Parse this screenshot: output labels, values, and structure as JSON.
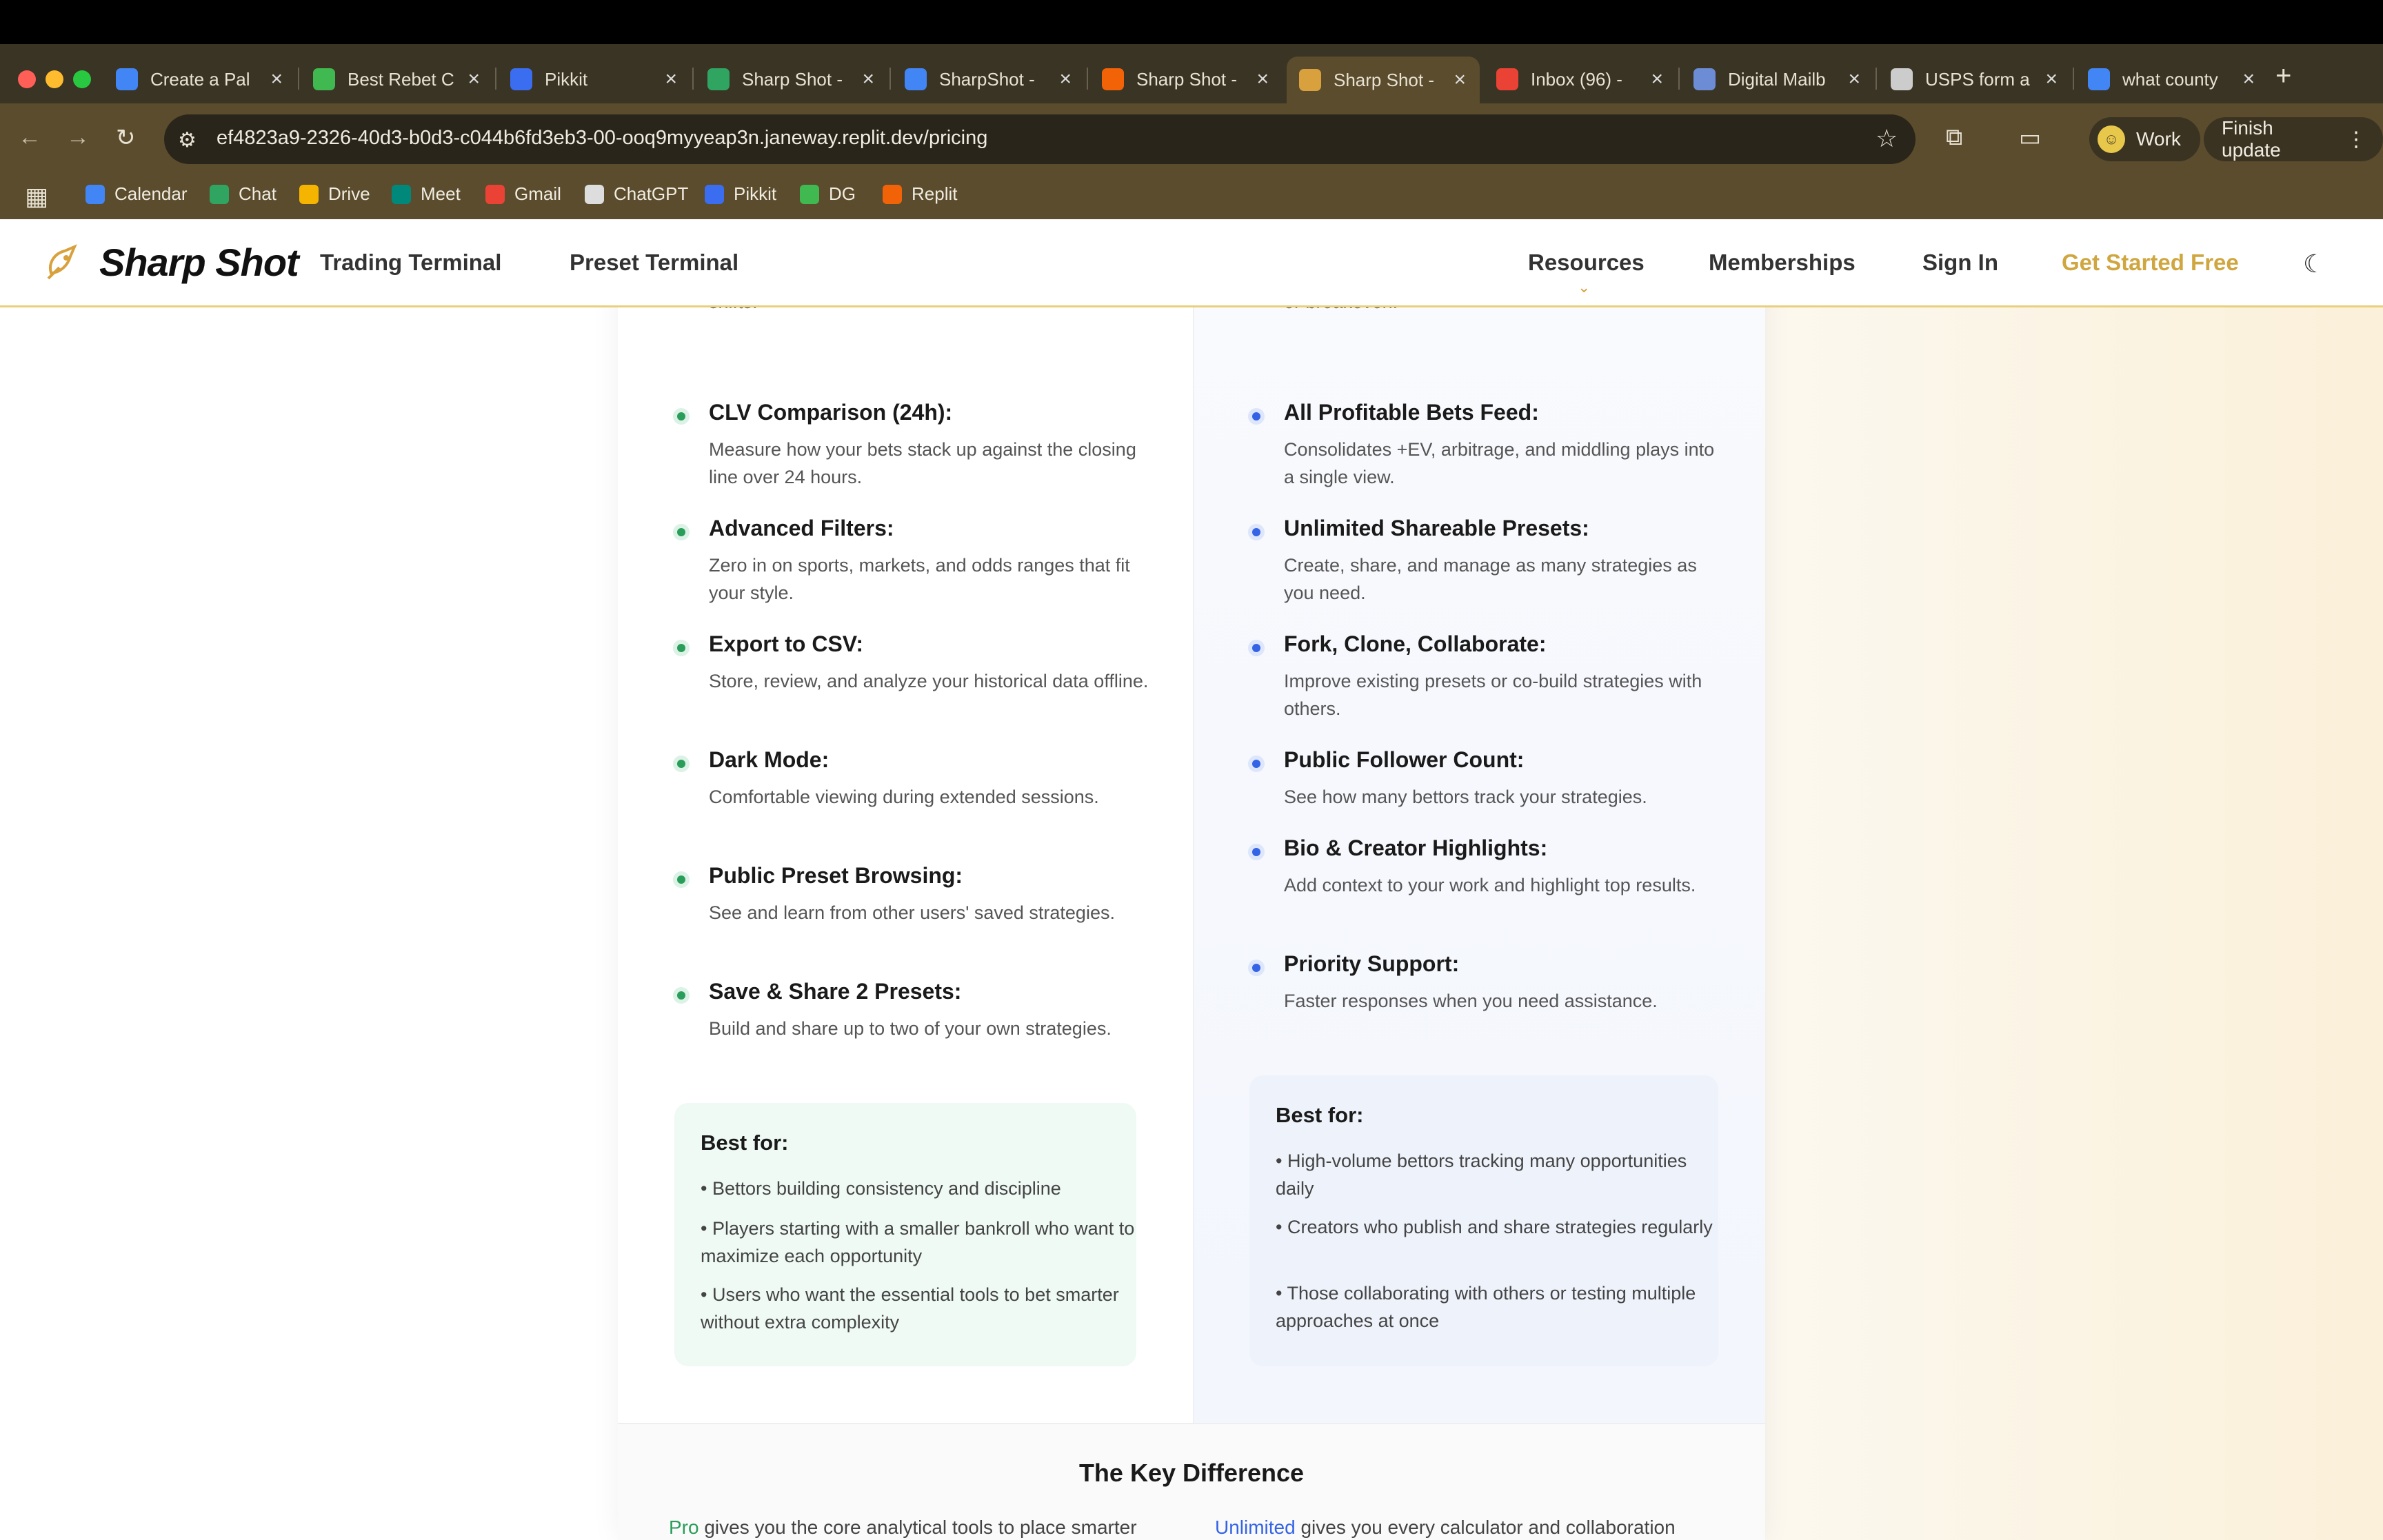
{
  "browser": {
    "tabs": [
      {
        "title": "Create a Pal",
        "favicon": "google-g-icon",
        "color": "#4285f4"
      },
      {
        "title": "Best Rebet C",
        "favicon": "link-icon",
        "color": "#3fb950"
      },
      {
        "title": "Pikkit",
        "favicon": "pikkit-icon",
        "color": "#3b6df0"
      },
      {
        "title": "Sharp Shot -",
        "favicon": "chat-icon",
        "color": "#2fa561"
      },
      {
        "title": "SharpShot -",
        "favicon": "calendar-icon",
        "color": "#4285f4"
      },
      {
        "title": "Sharp Shot -",
        "favicon": "replit-icon",
        "color": "#f26207"
      },
      {
        "title": "Sharp Shot -",
        "favicon": "sharpshot-icon",
        "color": "#d9a13e"
      },
      {
        "title": "Inbox (96) -",
        "favicon": "gmail-icon",
        "color": "#ea4335"
      },
      {
        "title": "Digital Mailb",
        "favicon": "cloud-icon",
        "color": "#6c8cd5"
      },
      {
        "title": "USPS form a",
        "favicon": "chatgpt-icon",
        "color": "#cccccc"
      },
      {
        "title": "what county",
        "favicon": "google-g-icon",
        "color": "#4285f4"
      }
    ],
    "url": "ef4823a9-2326-40d3-b0d3-c044b6fd3eb3-00-ooq9myyeap3n.janeway.replit.dev/pricing",
    "profile_label": "Work",
    "finish_update_label": "Finish update",
    "bookmarks": [
      {
        "label": "Calendar",
        "icon": "calendar-icon",
        "color": "#4285f4"
      },
      {
        "label": "Chat",
        "icon": "chat-icon",
        "color": "#2fa561"
      },
      {
        "label": "Drive",
        "icon": "drive-icon",
        "color": "#f4b400"
      },
      {
        "label": "Meet",
        "icon": "meet-icon",
        "color": "#00897b"
      },
      {
        "label": "Gmail",
        "icon": "gmail-icon",
        "color": "#ea4335"
      },
      {
        "label": "ChatGPT",
        "icon": "chatgpt-icon",
        "color": "#dddddd"
      },
      {
        "label": "Pikkit",
        "icon": "pikkit-icon",
        "color": "#3b6df0"
      },
      {
        "label": "DG",
        "icon": "link-icon",
        "color": "#3fb950"
      },
      {
        "label": "Replit",
        "icon": "replit-icon",
        "color": "#f26207"
      }
    ]
  },
  "site": {
    "logo": "Sharp Shot",
    "nav": {
      "trading_terminal": "Trading Terminal",
      "preset_terminal": "Preset Terminal",
      "resources": "Resources",
      "memberships": "Memberships",
      "sign_in": "Sign In",
      "get_started": "Get Started Free"
    },
    "colors": {
      "gold": "#cfa63f",
      "green": "#2a9d5a",
      "blue": "#3463e6"
    }
  },
  "pro": {
    "features": [
      {
        "title": "",
        "desc": "Watch line movement and react before the market shifts."
      },
      {
        "title": "CLV Comparison (24h):",
        "desc": "Measure how your bets stack up against the closing line over 24 hours."
      },
      {
        "title": "Advanced Filters:",
        "desc": "Zero in on sports, markets, and odds ranges that fit your style."
      },
      {
        "title": "Export to CSV:",
        "desc": "Store, review, and analyze your historical data offline."
      },
      {
        "title": "Dark Mode:",
        "desc": "Comfortable viewing during extended sessions."
      },
      {
        "title": "Public Preset Browsing:",
        "desc": "See and learn from other users' saved strategies."
      },
      {
        "title": "Save & Share 2 Presets:",
        "desc": "Build and share up to two of your own strategies."
      }
    ],
    "best_for_title": "Best for:",
    "best_for": [
      "• Bettors building consistency and discipline",
      "• Players starting with a smaller bankroll who want to maximize each opportunity",
      "• Users who want the essential tools to bet smarter without extra complexity"
    ]
  },
  "unlimited": {
    "features": [
      {
        "title": "",
        "desc": "Spot situations where multiple outcomes lead to profit or breakeven."
      },
      {
        "title": "All Profitable Bets Feed:",
        "desc": "Consolidates +EV, arbitrage, and middling plays into a single view."
      },
      {
        "title": "Unlimited Shareable Presets:",
        "desc": "Create, share, and manage as many strategies as you need."
      },
      {
        "title": "Fork, Clone, Collaborate:",
        "desc": "Improve existing presets or co-build strategies with others."
      },
      {
        "title": "Public Follower Count:",
        "desc": "See how many bettors track your strategies."
      },
      {
        "title": "Bio & Creator Highlights:",
        "desc": "Add context to your work and highlight top results."
      },
      {
        "title": "Priority Support:",
        "desc": "Faster responses when you need assistance."
      }
    ],
    "best_for_title": "Best for:",
    "best_for": [
      "• High-volume bettors tracking many opportunities daily",
      "• Creators who publish and share strategies regularly",
      "• Those collaborating with others or testing multiple approaches at once"
    ]
  },
  "key_difference": {
    "title": "The Key Difference",
    "left_highlight": "Pro",
    "left_text": " gives you the core analytical tools to place smarter",
    "right_highlight": "Unlimited",
    "right_text": " gives you every calculator and collaboration"
  }
}
